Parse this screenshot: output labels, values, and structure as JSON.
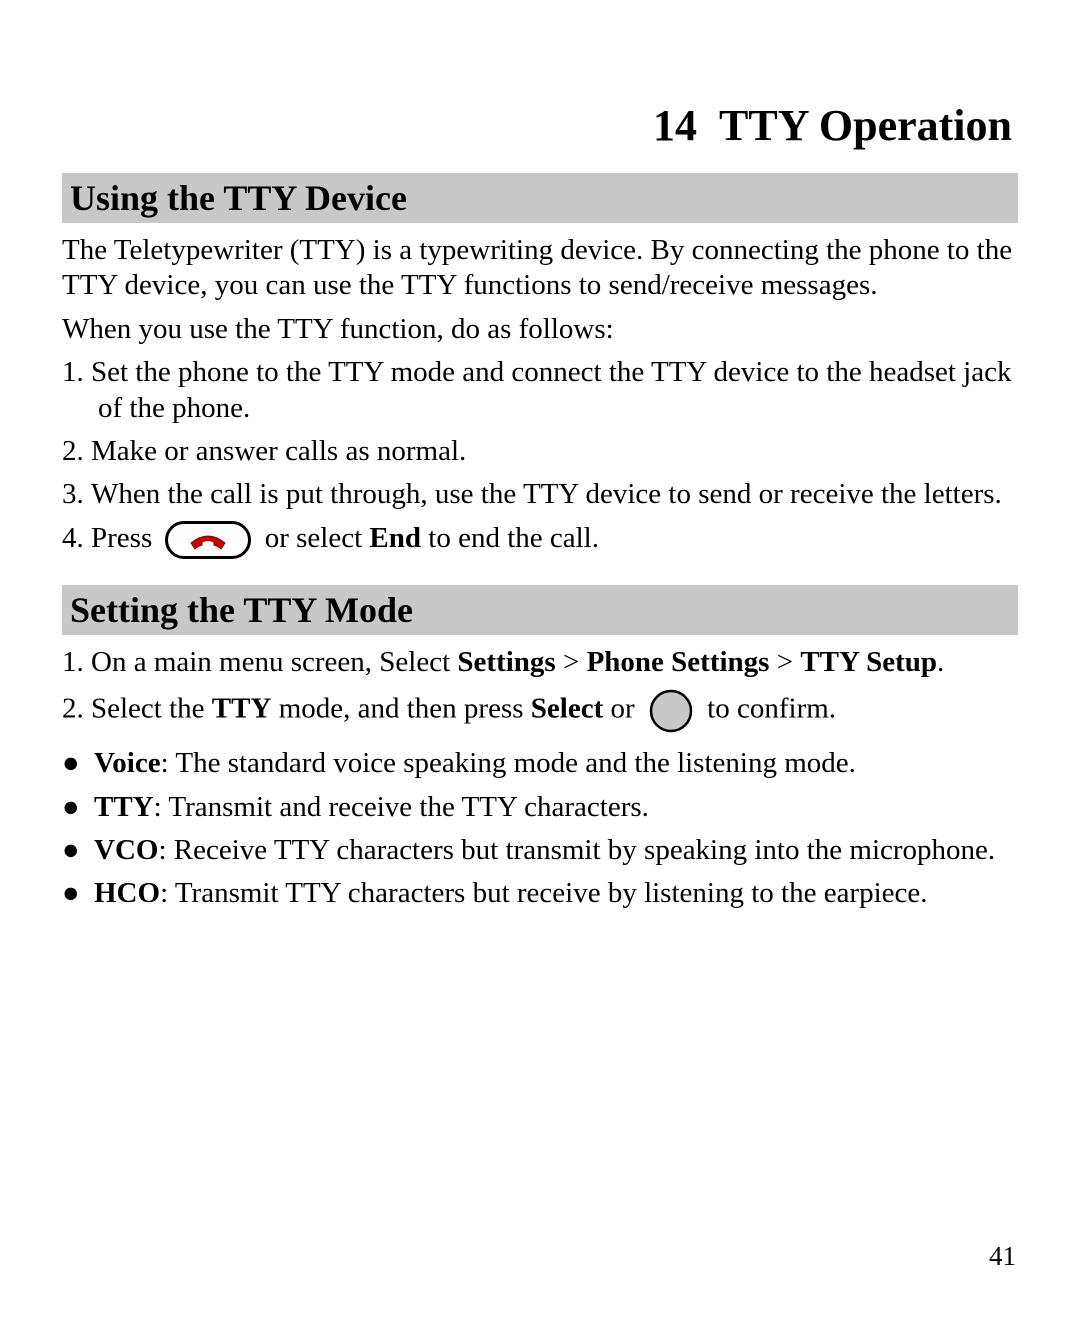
{
  "chapter": {
    "number": "14",
    "title": "TTY Operation"
  },
  "section1": {
    "heading": "Using the TTY Device",
    "para1": "The Teletypewriter (TTY) is a typewriting device. By connecting the phone to the TTY device, you can use the TTY functions to send/receive messages.",
    "para2": "When you use the TTY function, do as follows:",
    "step1_num": "1.",
    "step1": "Set the phone to the TTY mode and connect the TTY device to the headset jack of the phone.",
    "step2_num": "2.",
    "step2": "Make or answer calls as normal.",
    "step3_num": "3.",
    "step3": "When the call is put through, use the TTY device to send or receive the letters.",
    "step4_num": "4.",
    "step4_a": "Press ",
    "step4_b": " or select ",
    "step4_end": "End",
    "step4_c": " to end the call."
  },
  "section2": {
    "heading": "Setting the TTY Mode",
    "step1_num": "1.",
    "step1_a": "On a main menu screen, Select ",
    "step1_path1": "Settings",
    "gt1": " > ",
    "step1_path2": "Phone Settings",
    "gt2": " > ",
    "step1_path3": "TTY Setup",
    "step1_end": ".",
    "step2_num": "2.",
    "step2_a": "Select the ",
    "step2_tty": "TTY",
    "step2_b": " mode, and then press ",
    "step2_select": "Select",
    "step2_c": " or ",
    "step2_d": " to confirm.",
    "bullet": "●",
    "b1_label": "Voice",
    "b1_text": ": The standard voice speaking mode and the listening mode.",
    "b2_label": "TTY",
    "b2_text": ": Transmit and receive the TTY characters.",
    "b3_label": "VCO",
    "b3_text": ": Receive TTY characters but transmit by speaking into the microphone.",
    "b4_label": "HCO",
    "b4_text": ": Transmit TTY characters but receive by listening to the earpiece."
  },
  "page_number": "41"
}
